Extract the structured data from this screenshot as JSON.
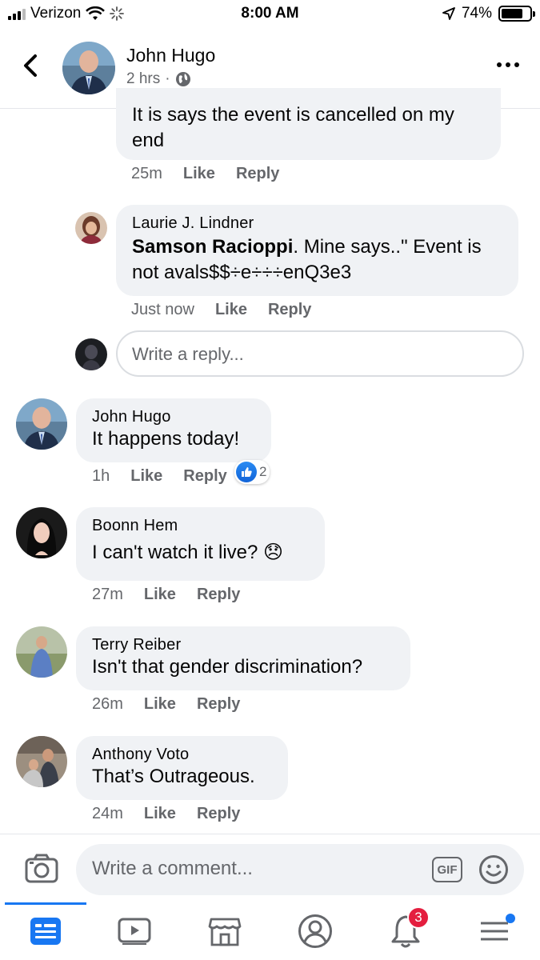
{
  "status_bar": {
    "carrier": "Verizon",
    "time": "8:00 AM",
    "battery": "74%",
    "battery_level": 0.74
  },
  "header": {
    "name": "John Hugo",
    "time": "2 hrs",
    "dot": "·"
  },
  "comments": [
    {
      "text": "It is says the event is cancelled on my end",
      "time": "25m",
      "like": "Like",
      "reply": "Reply"
    },
    {
      "author": "Laurie J. Lindner",
      "mention": "Samson Racioppi",
      "text": ". Mine says..\" Event is not avals$$÷e÷÷÷enQ3e3",
      "time": "Just now",
      "like": "Like",
      "reply": "Reply"
    },
    {
      "author": "John Hugo",
      "text": "It happens today!",
      "time": "1h",
      "like": "Like",
      "reply": "Reply",
      "reactions": "2"
    },
    {
      "author": "Boonn Hem",
      "text": "I can't watch it live? 😞",
      "time": "27m",
      "like": "Like",
      "reply": "Reply"
    },
    {
      "author": "Terry Reiber",
      "text": "Isn't that gender discrimination?",
      "time": "26m",
      "like": "Like",
      "reply": "Reply"
    },
    {
      "author": "Anthony Voto",
      "text": "That’s Outrageous.",
      "time": "24m",
      "like": "Like",
      "reply": "Reply"
    }
  ],
  "reply_box": {
    "placeholder": "Write a reply..."
  },
  "composer": {
    "placeholder": "Write a comment...",
    "gif": "GIF"
  },
  "tabbar": {
    "notifications_badge": "3",
    "active_tab": "news-feed"
  },
  "colors": {
    "accent": "#1877f2",
    "bubble": "#f0f2f5",
    "muted": "#65676b",
    "badge": "#e41e3f"
  }
}
